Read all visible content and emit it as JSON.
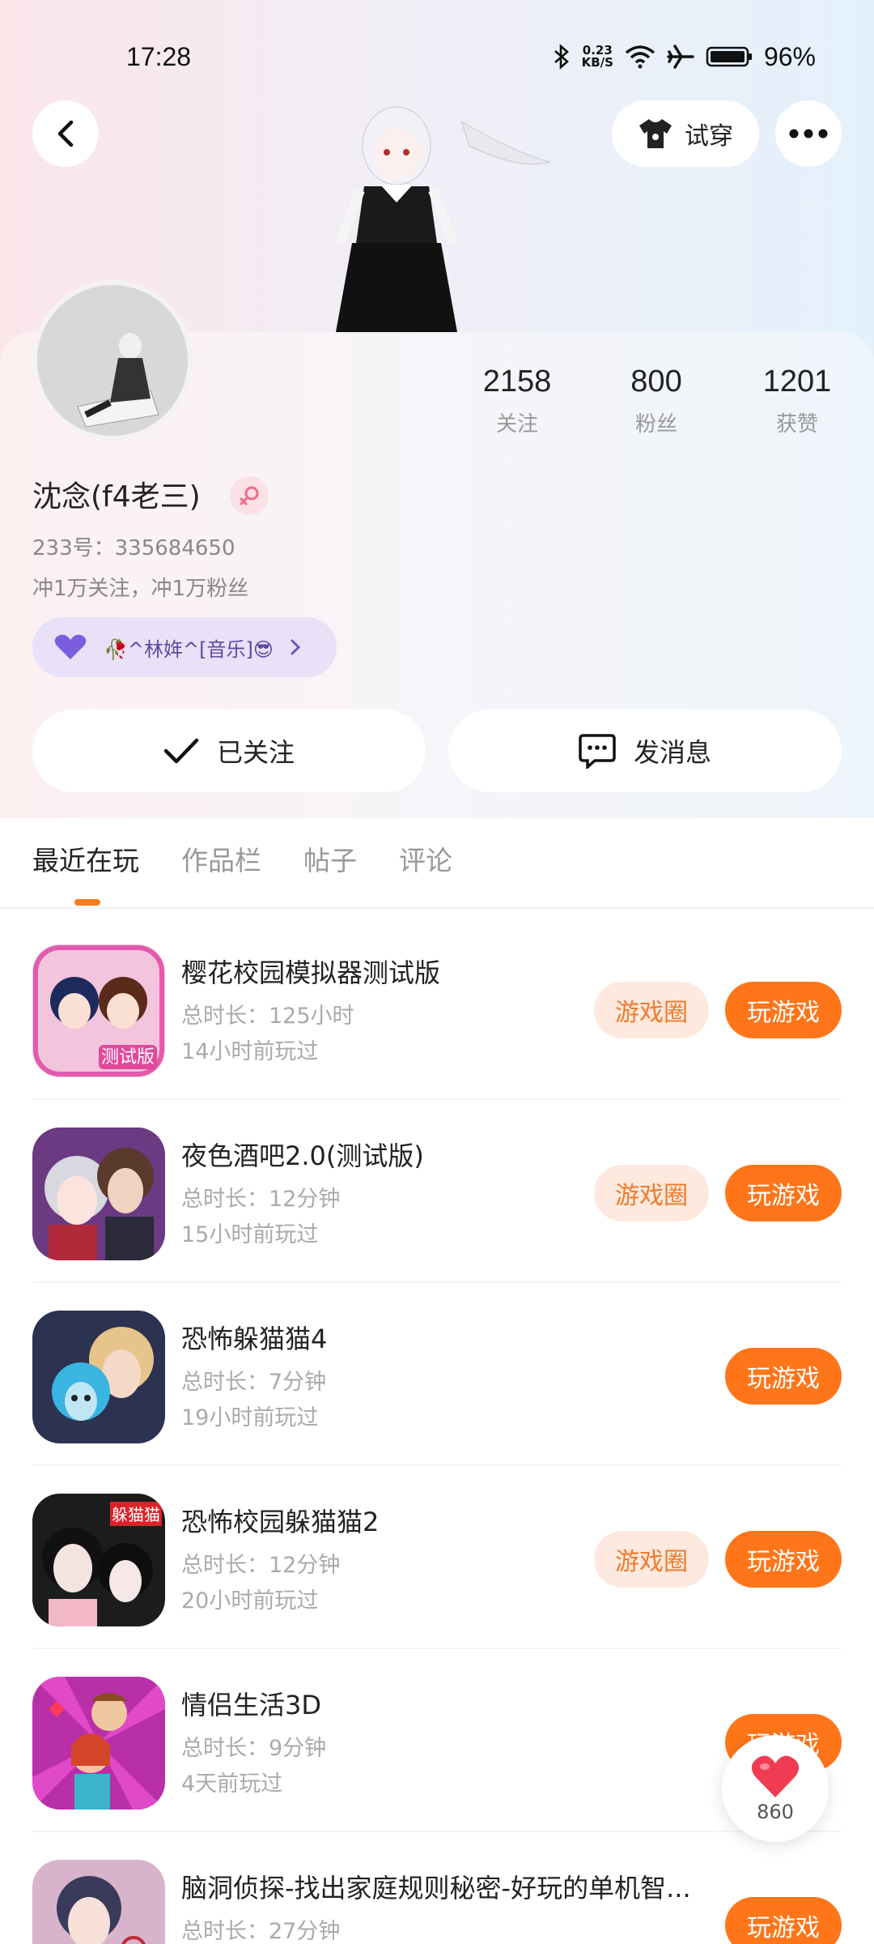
{
  "status_bar": {
    "time": "17:28",
    "net_speed_value": "0.23",
    "net_speed_unit": "KB/S",
    "battery": "96%"
  },
  "header": {
    "tryon_label": "试穿"
  },
  "profile": {
    "stats": [
      {
        "value": "2158",
        "label": "关注"
      },
      {
        "value": "800",
        "label": "粉丝"
      },
      {
        "value": "1201",
        "label": "获赞"
      }
    ],
    "username": "沈念(f4老三)",
    "uid": "233号：335684650",
    "bio": "冲1万关注，冲1万粉丝",
    "music": "🥀^林姩^[音乐]😎"
  },
  "actions": {
    "following_label": "已关注",
    "message_label": "发消息"
  },
  "tabs": [
    {
      "label": "最近在玩",
      "active": true
    },
    {
      "label": "作品栏",
      "active": false
    },
    {
      "label": "帖子",
      "active": false
    },
    {
      "label": "评论",
      "active": false
    }
  ],
  "games": [
    {
      "name": "樱花校园模拟器测试版",
      "duration": "总时长：125小时",
      "last_played": "14小时前玩过",
      "has_circle": true,
      "circle_label": "游戏圈",
      "play_label": "玩游戏",
      "icon_color": "#e8a4c8"
    },
    {
      "name": "夜色酒吧2.0(测试版)",
      "duration": "总时长：12分钟",
      "last_played": "15小时前玩过",
      "has_circle": true,
      "circle_label": "游戏圈",
      "play_label": "玩游戏",
      "icon_color": "#7a4a8c"
    },
    {
      "name": "恐怖躲猫猫4",
      "duration": "总时长：7分钟",
      "last_played": "19小时前玩过",
      "has_circle": false,
      "circle_label": "",
      "play_label": "玩游戏",
      "icon_color": "#3a4a6a"
    },
    {
      "name": "恐怖校园躲猫猫2",
      "duration": "总时长：12分钟",
      "last_played": "20小时前玩过",
      "has_circle": true,
      "circle_label": "游戏圈",
      "play_label": "玩游戏",
      "icon_color": "#2a2a2a"
    },
    {
      "name": "情侣生活3D",
      "duration": "总时长：9分钟",
      "last_played": "4天前玩过",
      "has_circle": false,
      "circle_label": "",
      "play_label": "玩游戏",
      "icon_color": "#c23aa8"
    },
    {
      "name": "脑洞侦探-找出家庭规则秘密-好玩的单机智...",
      "duration": "总时长：27分钟",
      "last_played": "",
      "has_circle": false,
      "circle_label": "",
      "play_label": "玩游戏",
      "icon_color": "#c9a0c0"
    }
  ],
  "like_fab": {
    "count": "860"
  },
  "colors": {
    "accent": "#ff7519",
    "accent_light": "#fde9de"
  }
}
